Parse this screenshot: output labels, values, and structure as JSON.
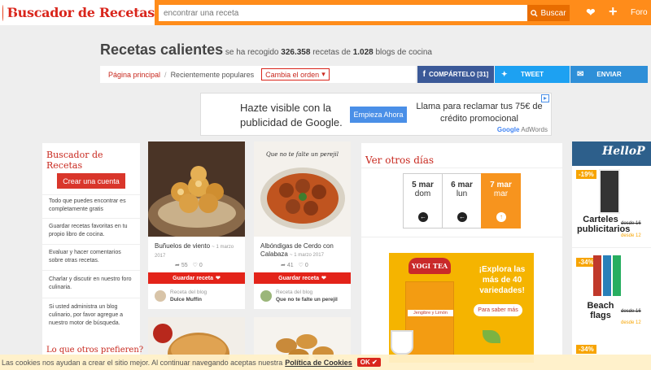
{
  "header": {
    "logo_text": "Buscador de Recetas",
    "search_placeholder": "encontrar una receta",
    "search_button": "Buscar",
    "forum_link": "Foro"
  },
  "headline": {
    "title": "Recetas calientes",
    "text_1": "se ha recogido",
    "recipes_count": "326.358",
    "text_2": "recetas de",
    "blogs_count": "1.028",
    "text_3": "blogs de cocina"
  },
  "nav": {
    "home": "Página principal",
    "popular": "Recientemente populares",
    "order": "Cambia el orden"
  },
  "share": {
    "facebook": "COMPÁRTELO [31]",
    "twitter": "TWEET",
    "email": "ENVIAR"
  },
  "ad_banner": {
    "line1": "Hazte visible con la",
    "line2": "publicidad de Google.",
    "button": "Empieza Ahora",
    "right_line1": "Llama para reclamar tus 75€ de",
    "right_line2": "crédito promocional",
    "brand_google": "Google",
    "brand_adwords": "AdWords"
  },
  "sidebar": {
    "title": "Buscador de Recetas",
    "create_button": "Crear una cuenta",
    "items": [
      "Todo que puedes encontrar es completamente gratis",
      "Guardar recetas favoritas en tu propio libro de cocina.",
      "Evaluar y hacer comentarios sobre otras recetas.",
      "Charlar y discutir en nuestro foro culinaria.",
      "Si usted administra un blog culinario, por favor agregue a nuestro motor de búsqueda."
    ],
    "next_heading": "Lo que otros prefieren?"
  },
  "cards": [
    {
      "title": "Buñuelos de viento",
      "date": "~ 1 marzo 2017",
      "views": "55",
      "likes": "0",
      "save_label": "Guardar receta",
      "blog_prefix": "Receta del blog",
      "blog_name": "Dulce Muffin"
    },
    {
      "title": "Albóndigas de Cerdo con Calabaza",
      "date": "~ 1 marzo 2017",
      "views": "41",
      "likes": "0",
      "save_label": "Guardar receta",
      "blog_prefix": "Receta del blog",
      "blog_name": "Que no te falte un perejil",
      "image_caption": "Que no te falte un perejil"
    }
  ],
  "right_panel": {
    "title": "Ver otros días",
    "days": [
      {
        "day": "5 mar",
        "weekday": "dom"
      },
      {
        "day": "6 mar",
        "weekday": "lun"
      },
      {
        "day": "7 mar",
        "weekday": "mar"
      }
    ]
  },
  "yogi_ad": {
    "brand": "YOGI TEA",
    "headline": "¡Explora las más de 40 variedades!",
    "button": "Para saber más",
    "box_label": "Jengibre y Limón"
  },
  "far_right": {
    "brand": "HelloP",
    "products": [
      {
        "badge": "-19%",
        "name": "Carteles publicitarios",
        "old_price": "desde 16",
        "new_price": "desde 12"
      },
      {
        "badge": "-34%",
        "name": "Beach flags",
        "old_price": "desde 16",
        "new_price": "desde 12"
      },
      {
        "badge": "-34%"
      }
    ]
  },
  "cookie_bar": {
    "text": "Las cookies nos ayudan a crear el sitio mejor. Al continuar navegando aceptas nuestra",
    "link": "Política de Cookies",
    "ok": "OK"
  }
}
